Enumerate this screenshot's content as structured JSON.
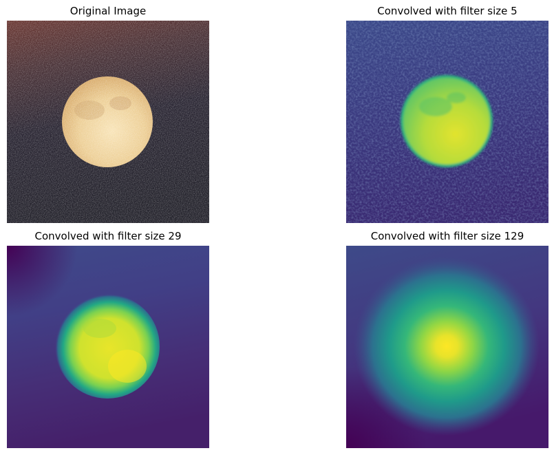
{
  "figure": {
    "panels": [
      {
        "title": "Original Image",
        "kind": "rgb-photo"
      },
      {
        "title": "Convolved with filter size 5",
        "kind": "viridis",
        "filter_size": 5
      },
      {
        "title": "Convolved with filter size 29",
        "kind": "viridis",
        "filter_size": 29
      },
      {
        "title": "Convolved with filter size 129",
        "kind": "viridis",
        "filter_size": 129
      }
    ],
    "colors": {
      "background": "#ffffff",
      "viridis_low": "#440154",
      "viridis_mid": "#21918c",
      "viridis_high": "#fde725",
      "moon_light": "#f3d9a6",
      "moon_dark": "#c99a5a",
      "sky_dark": "#2b2733",
      "sky_red": "#7a3a34"
    }
  }
}
